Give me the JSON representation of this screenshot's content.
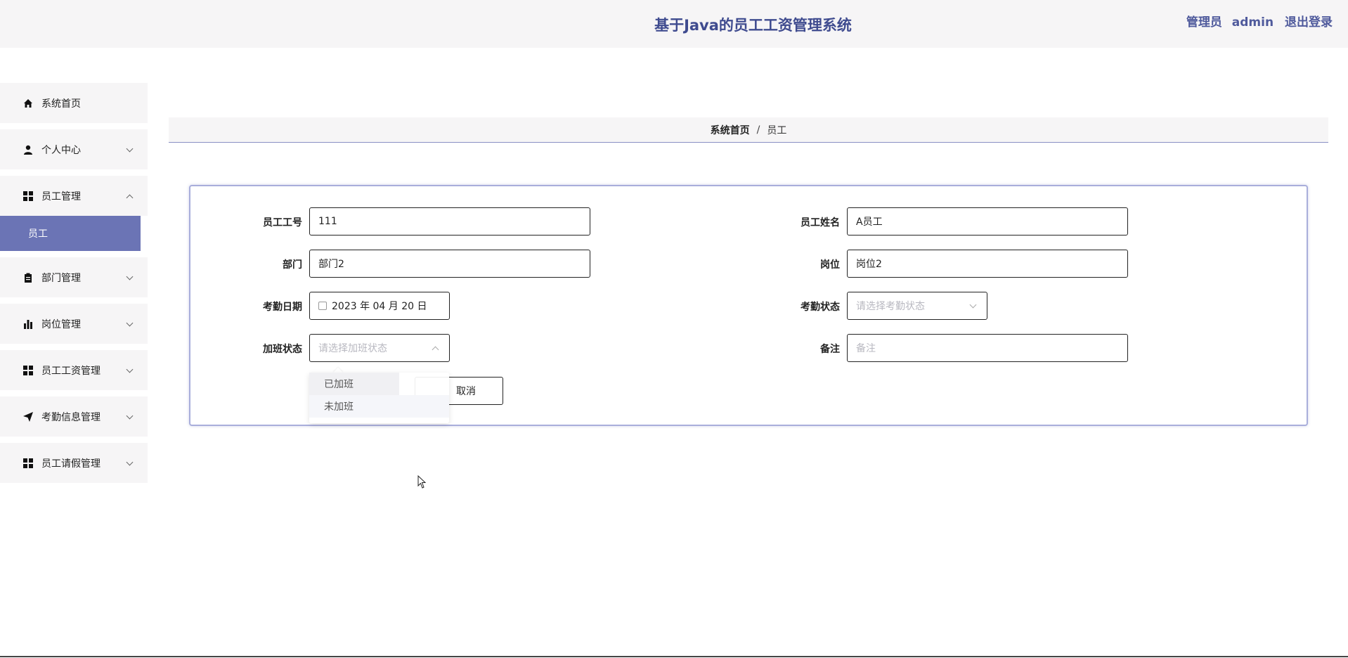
{
  "header": {
    "app_title": "基于Java的员工工资管理系统",
    "role": "管理员",
    "username": "admin",
    "logout": "退出登录",
    "title_color": "#3f4b8f"
  },
  "sidebar": {
    "items": [
      {
        "label": "系统首页",
        "icon": "home-icon"
      },
      {
        "label": "个人中心",
        "icon": "user-icon"
      },
      {
        "label": "员工管理",
        "icon": "grid-icon",
        "expanded": true,
        "children": [
          {
            "label": "员工",
            "active": true
          }
        ]
      },
      {
        "label": "部门管理",
        "icon": "clipboard-icon"
      },
      {
        "label": "岗位管理",
        "icon": "bar-chart-icon"
      },
      {
        "label": "员工工资管理",
        "icon": "grid-icon"
      },
      {
        "label": "考勤信息管理",
        "icon": "send-icon"
      },
      {
        "label": "员工请假管理",
        "icon": "grid-icon"
      }
    ],
    "active_color": "#6b74b5"
  },
  "breadcrumb": {
    "home": "系统首页",
    "separator": "/",
    "current": "员工"
  },
  "form": {
    "emp_no": {
      "label": "员工工号",
      "value": "111"
    },
    "emp_name": {
      "label": "员工姓名",
      "value": "A员工"
    },
    "department": {
      "label": "部门",
      "value": "部门2"
    },
    "position": {
      "label": "岗位",
      "value": "岗位2"
    },
    "attendance_date": {
      "label": "考勤日期",
      "value": "2023 年 04 月 20 日"
    },
    "attendance_status": {
      "label": "考勤状态",
      "placeholder": "请选择考勤状态"
    },
    "overtime_status": {
      "label": "加班状态",
      "placeholder": "请选择加班状态"
    },
    "remark": {
      "label": "备注",
      "placeholder": "备注"
    },
    "cancel_label": "取消",
    "overtime_options": [
      "已加班",
      "未加班"
    ]
  }
}
